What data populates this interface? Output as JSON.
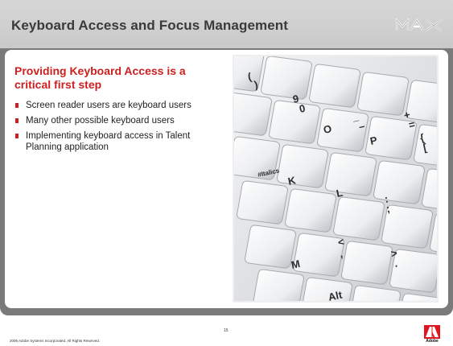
{
  "header": {
    "title": "Keyboard Access and Focus Management",
    "brand_logo": "MAX"
  },
  "content": {
    "subtitle": "Providing Keyboard Access is a critical first step",
    "bullets": [
      "Screen reader users are keyboard users",
      "Many other possible keyboard users",
      "Implementing keyboard access in Talent Planning application"
    ]
  },
  "photo": {
    "key_labels": [
      "(",
      ")",
      "9",
      "0",
      "_",
      "–",
      "+",
      "=",
      "O",
      "P",
      "{",
      "[",
      "#Italics",
      "K",
      "L",
      ":",
      ";",
      "<",
      ",",
      ">",
      ".",
      "M",
      "Alt"
    ]
  },
  "footer": {
    "copyright": "2006 Adobe Systems Incorporated.  All Rights Reserved.",
    "page_number": "15",
    "company_logo": "Adobe"
  },
  "colors": {
    "accent": "#cc1f1f",
    "frame": "#7a7a7a",
    "header": "#d0d0d0"
  }
}
